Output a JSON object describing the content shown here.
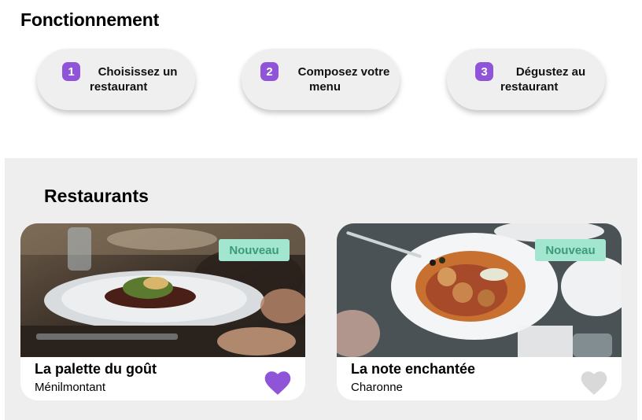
{
  "how_it_works": {
    "title": "Fonctionnement",
    "steps": [
      {
        "number": "1",
        "line1": "Choisissez un",
        "line2": "restaurant"
      },
      {
        "number": "2",
        "line1": "Composez votre",
        "line2": "menu"
      },
      {
        "number": "3",
        "line1": "Dégustez au",
        "line2": "restaurant"
      }
    ]
  },
  "restaurants": {
    "title": "Restaurants",
    "cards": [
      {
        "badge": "Nouveau",
        "name": "La palette du goût",
        "area": "Ménilmontant",
        "favorite": true,
        "heart_icon": "heart-icon"
      },
      {
        "badge": "Nouveau",
        "name": "La note enchantée",
        "area": "Charonne",
        "favorite": false,
        "heart_icon": "heart-icon"
      }
    ]
  },
  "colors": {
    "accent": "#8f54d8",
    "badge_bg": "#a3e6cf",
    "badge_text": "#3d9a79",
    "section_bg": "#eeeeee",
    "heart_inactive": "#d9d9d9"
  }
}
